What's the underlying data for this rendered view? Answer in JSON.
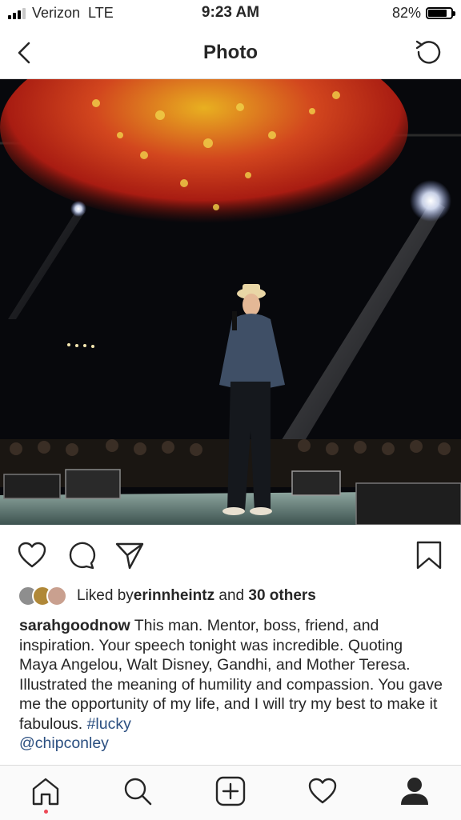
{
  "status_bar": {
    "carrier": "Verizon",
    "network": "LTE",
    "time": "9:23 AM",
    "battery_percent": "82%",
    "battery_level": 0.82
  },
  "nav": {
    "title": "Photo",
    "back_icon": "chevron-left-icon",
    "refresh_icon": "refresh-icon"
  },
  "post": {
    "actions": [
      "heart-icon",
      "comment-icon",
      "share-icon",
      "bookmark-icon"
    ],
    "likes": {
      "prefix": "Liked by ",
      "user": "erinnheintz",
      "middle": " and ",
      "others": "30 others"
    },
    "caption": {
      "username": "sarahgoodnow",
      "text": " This man. Mentor, boss, friend, and inspiration. Your speech tonight was incredible. Quoting Maya Angelou, Walt Disney, Gandhi, and Mother Teresa.  Illustrated the meaning of humility and compassion. You gave me the opportunity of my life, and I will try my best to make it fabulous. ",
      "hashtag": "#lucky",
      "mention": "@chipconley"
    }
  },
  "tab_bar": [
    "home-icon",
    "search-icon",
    "add-post-icon",
    "activity-icon",
    "profile-icon"
  ],
  "colors": {
    "link": "#2b4f80",
    "text": "#262626",
    "notification_dot": "#ed4956"
  }
}
